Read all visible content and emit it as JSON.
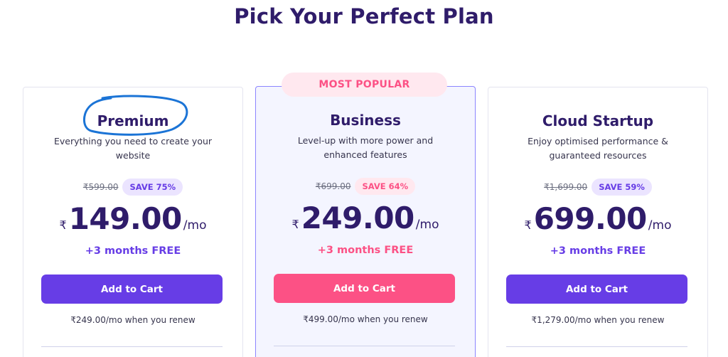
{
  "page": {
    "title": "Pick Your Perfect Plan"
  },
  "ribbon": {
    "label": "MOST POPULAR"
  },
  "plans": [
    {
      "name": "Premium",
      "description": "Everything you need to create your website",
      "old_price": "₹599.00",
      "save_label": "SAVE 75%",
      "currency": "₹",
      "price": "149.00",
      "period": "/mo",
      "bonus": "+3 months FREE",
      "button_label": "Add to Cart",
      "renew_text": "₹249.00/mo when you renew"
    },
    {
      "name": "Business",
      "description": "Level-up with more power and enhanced features",
      "old_price": "₹699.00",
      "save_label": "SAVE 64%",
      "currency": "₹",
      "price": "249.00",
      "period": "/mo",
      "bonus": "+3 months FREE",
      "button_label": "Add to Cart",
      "renew_text": "₹499.00/mo when you renew"
    },
    {
      "name": "Cloud Startup",
      "description": "Enjoy optimised performance & guaranteed resources",
      "old_price": "₹1,699.00",
      "save_label": "SAVE 59%",
      "currency": "₹",
      "price": "699.00",
      "period": "/mo",
      "bonus": "+3 months FREE",
      "button_label": "Add to Cart",
      "renew_text": "₹1,279.00/mo when you renew"
    }
  ],
  "colors": {
    "heading": "#2f1c6a",
    "primary": "#673de6",
    "popular_accent": "#fc5185",
    "featured_background": "#f4f5ff",
    "annotation": "#1b74d6"
  }
}
